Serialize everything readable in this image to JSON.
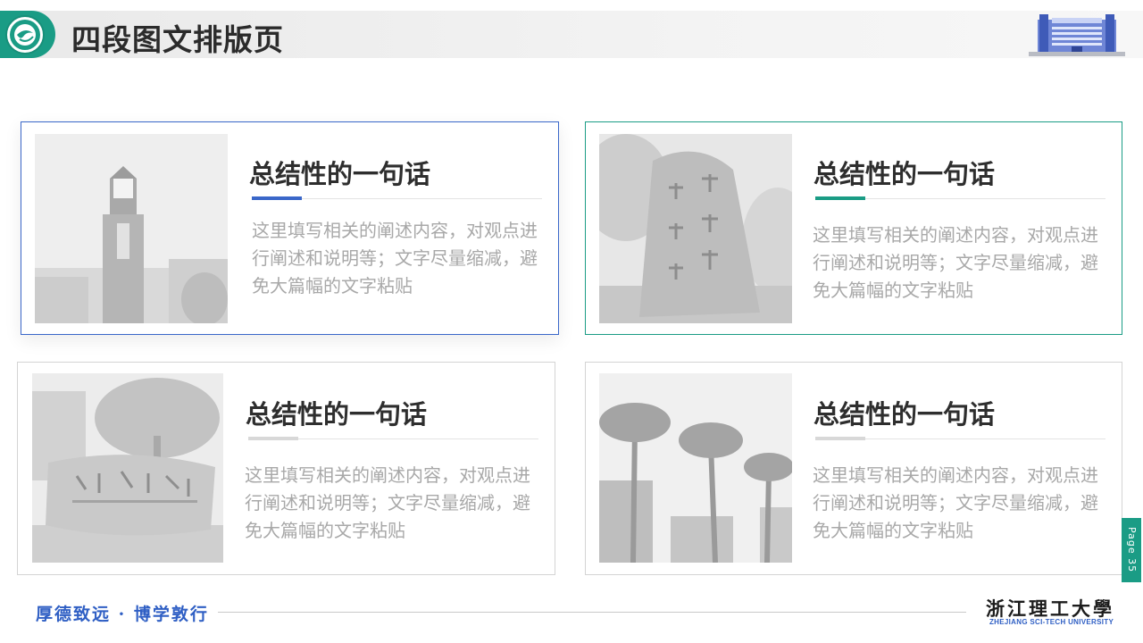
{
  "header": {
    "title": "四段图文排版页"
  },
  "cards": [
    {
      "heading": "总结性的一句话",
      "body": "这里填写相关的阐述内容，对观点进行阐述和说明等；文字尽量缩减，避免大篇幅的文字粘贴",
      "photo_alt": "clock-tower-photo",
      "accent": "#3a67c9",
      "border": "#3a67c9"
    },
    {
      "heading": "总结性的一句话",
      "body": "这里填写相关的阐述内容，对观点进行阐述和说明等；文字尽量缩减，避免大篇幅的文字粘贴",
      "photo_alt": "motto-stone-photo",
      "accent": "#1a9c85",
      "border": "#1a9c85"
    },
    {
      "heading": "总结性的一句话",
      "body": "这里填写相关的阐述内容，对观点进行阐述和说明等；文字尽量缩减，避免大篇幅的文字粘贴",
      "photo_alt": "campus-stone-photo",
      "accent": "#d8d8d8",
      "border": "#d4d4d4"
    },
    {
      "heading": "总结性的一句话",
      "body": "这里填写相关的阐述内容，对观点进行阐述和说明等；文字尽量缩减，避免大篇幅的文字粘贴",
      "photo_alt": "palm-trees-photo",
      "accent": "#d8d8d8",
      "border": "#d4d4d4"
    }
  ],
  "page_indicator": "Page 35",
  "footer": {
    "motto": "厚德致远 · 博学敦行",
    "university_cn": "浙江理工大學",
    "university_en": "ZHEJIANG SCI-TECH UNIVERSITY"
  },
  "colors": {
    "brand_green": "#1a9c85",
    "brand_blue": "#3a67c9"
  }
}
